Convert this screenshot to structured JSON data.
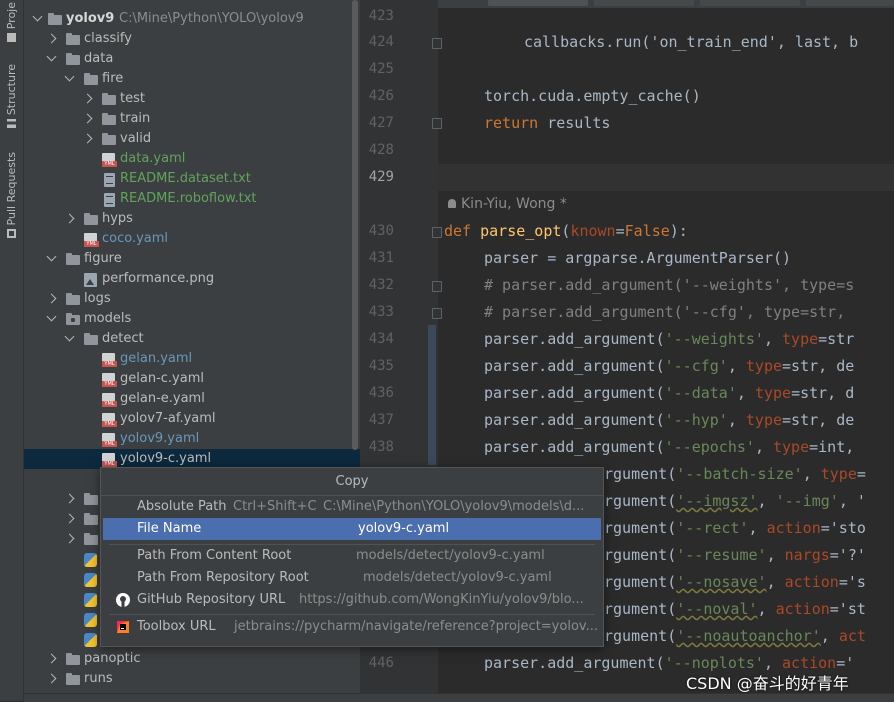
{
  "side_tabs": {
    "project": "Proje",
    "structure": "Structure",
    "pull_requests": "Pull Requests"
  },
  "tree": {
    "root_name": "yolov9",
    "root_path": "C:\\Mine\\Python\\YOLO\\yolov9",
    "items": [
      {
        "label": "classify"
      },
      {
        "label": "data"
      },
      {
        "label": "fire"
      },
      {
        "label": "test"
      },
      {
        "label": "train"
      },
      {
        "label": "valid"
      },
      {
        "label": "data.yaml"
      },
      {
        "label": "README.dataset.txt"
      },
      {
        "label": "README.roboflow.txt"
      },
      {
        "label": "hyps"
      },
      {
        "label": "coco.yaml"
      },
      {
        "label": "figure"
      },
      {
        "label": "performance.png"
      },
      {
        "label": "logs"
      },
      {
        "label": "models"
      },
      {
        "label": "detect"
      },
      {
        "label": "gelan.yaml"
      },
      {
        "label": "gelan-c.yaml"
      },
      {
        "label": "gelan-e.yaml"
      },
      {
        "label": "yolov7-af.yaml"
      },
      {
        "label": "yolov9.yaml"
      },
      {
        "label": "yolov9-c.yaml"
      },
      {
        "label": "panoptic"
      },
      {
        "label": "runs"
      }
    ]
  },
  "editor": {
    "line_numbers": [
      "423",
      "424",
      "425",
      "426",
      "427",
      "428",
      "429",
      "430",
      "431",
      "432",
      "433",
      "434",
      "435",
      "436",
      "437",
      "438",
      "446"
    ],
    "author": "Kin-Yiu, Wong *",
    "code": {
      "l424": "callbacks.run('on_train_end', last, b",
      "l426": "torch.cuda.empty_cache()",
      "l427_kw": "return",
      "l427_rest": " results",
      "l430_kw": "def",
      "l430_fn": "parse_opt",
      "l430_a": "(",
      "l430_p": "known",
      "l430_b": "=",
      "l430_c": "False",
      "l430_d": "):",
      "l431": "parser = argparse.ArgumentParser()",
      "l432": "# parser.add_argument('--weights', type=s",
      "l433": "# parser.add_argument('--cfg', type=str,",
      "p_add": "parser.add_argument(",
      "l434_s": "'--weights'",
      "l434_k": "type",
      "l434_v": "=str",
      "l435_s": "'--cfg'",
      "l435_k": "type",
      "l435_v": "=str, de",
      "l436_s": "'--data'",
      "l436_k": "type",
      "l436_v": "=str, d",
      "l437_s": "'--hyp'",
      "l437_k": "type",
      "l437_v": "=str, de",
      "l438_s": "'--epochs'",
      "l438_k": "type",
      "l438_v": "=int,",
      "arg": "rgument(",
      "l439_s": "'--batch-size'",
      "l439_k": "type",
      "l439_v": "=",
      "l440_s": "'--imgsz'",
      "l440_m": ", ",
      "l440_s2": "'--img'",
      "l440_e": ", '",
      "l441_s": "'--rect'",
      "l441_k": "action",
      "l441_v": "='sto",
      "l442_s": "'--resume'",
      "l442_k": "nargs",
      "l442_v": "='?'",
      "l443_s": "'--nosave'",
      "l443_k": "action",
      "l443_v": "='s",
      "l444_s": "'--noval'",
      "l444_k": "action",
      "l444_v": "='st",
      "l445_s": "'--noautoanchor'",
      "l445_k": "act",
      "l446_s": "'--noplots'",
      "l446_k": "action",
      "l446_v": "='",
      "comma": ", "
    }
  },
  "context_menu": {
    "title": "Copy",
    "items": [
      {
        "label": "Absolute Path",
        "shortcut": "Ctrl+Shift+C",
        "value": "C:\\Mine\\Python\\YOLO\\yolov9\\models\\d..."
      },
      {
        "label": "File Name",
        "value": "yolov9-c.yaml"
      },
      {
        "label": "Path From Content Root",
        "value": "models/detect/yolov9-c.yaml"
      },
      {
        "label": "Path From Repository Root",
        "value": "models/detect/yolov9-c.yaml"
      },
      {
        "label": "GitHub Repository URL",
        "value": "https://github.com/WongKinYiu/yolov9/blo..."
      },
      {
        "label": "Toolbox URL",
        "value": "jetbrains://pycharm/navigate/reference?project=yolov..."
      }
    ]
  },
  "watermark": "CSDN @奋斗的好青年",
  "colors": {
    "accent": "#4b6eaf",
    "tree_bg": "#3c3f41",
    "editor_bg": "#2b2b2b",
    "keyword": "#cc7832",
    "string": "#6a8759",
    "function": "#ffc66d",
    "git_added": "#62a35c",
    "git_modified": "#6897bb"
  }
}
